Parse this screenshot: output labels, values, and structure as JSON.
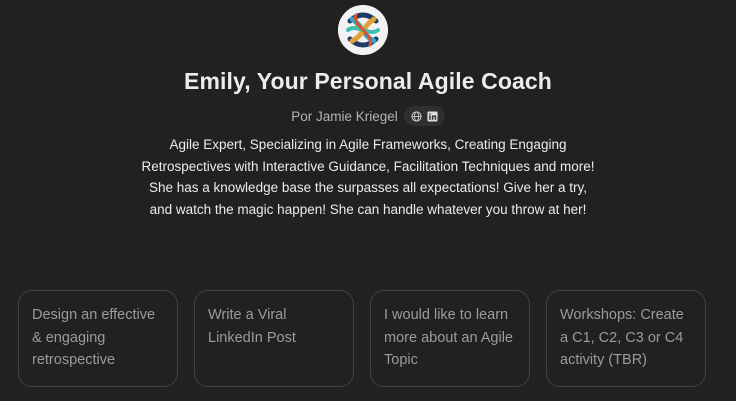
{
  "gpt": {
    "title": "Emily, Your Personal Agile Coach",
    "author": "Por Jamie Kriegel",
    "description": "Agile Expert, Specializing in Agile Frameworks, Creating Engaging Retrospectives with Interactive Guidance, Facilitation Techniques and more! She has a knowledge base the surpasses all expectations! Give her a try, and watch the magic happen! She can handle whatever you throw at her!",
    "links": [
      "globe-icon",
      "linkedin-icon"
    ]
  },
  "starters": [
    {
      "label": "Design an effective & engaging retrospective"
    },
    {
      "label": "Write a Viral LinkedIn Post"
    },
    {
      "label": "I would like to learn more about an Agile Topic"
    },
    {
      "label": "Workshops: Create a C1, C2, C3 or C4 activity (TBR)"
    }
  ]
}
